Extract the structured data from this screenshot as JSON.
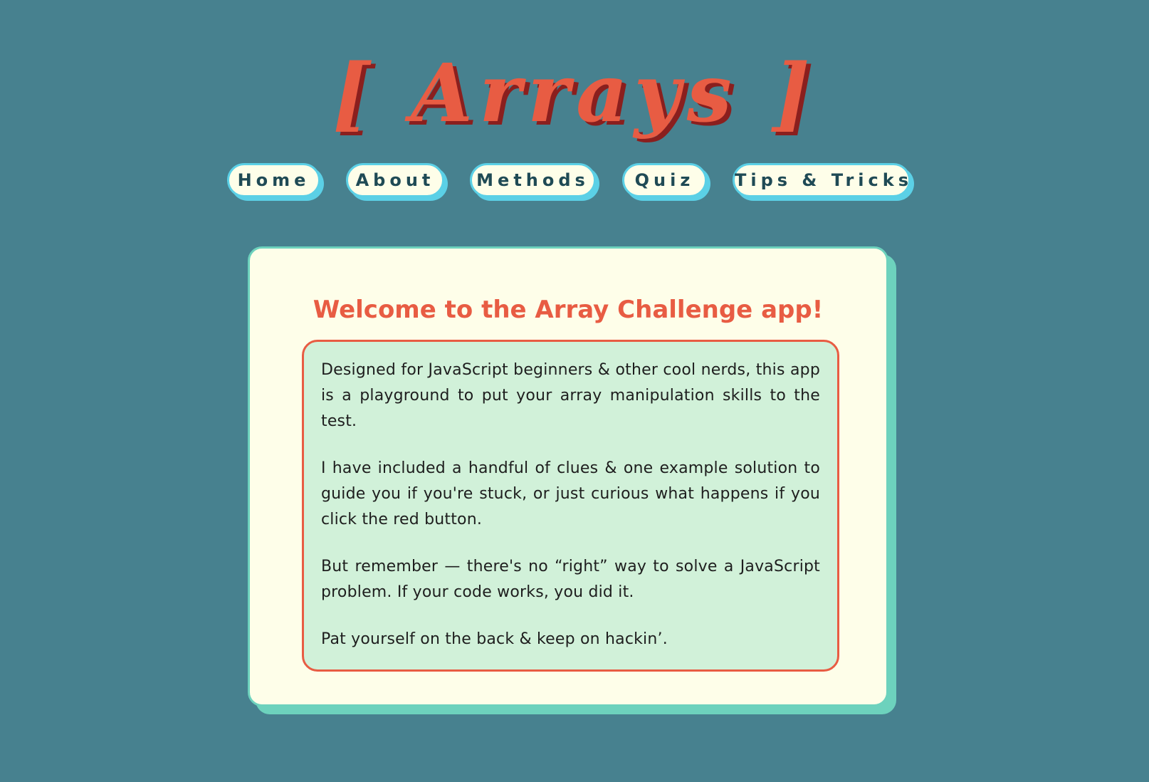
{
  "header": {
    "logo_text": "[ Arrays ]"
  },
  "nav": {
    "items": [
      {
        "label": "Home"
      },
      {
        "label": "About"
      },
      {
        "label": "Methods"
      },
      {
        "label": "Quiz"
      },
      {
        "label": "Tips & Tricks"
      }
    ]
  },
  "main": {
    "title": "Welcome to the Array Challenge app!",
    "paragraphs": [
      "Designed for JavaScript beginners & other cool nerds, this app is a playground to put your array manipulation skills to the test.",
      "I have included a handful of clues & one example solution to guide you if you're stuck, or just curious what happens if you click the red button.",
      "But remember — there's no “right” way to solve a JavaScript problem. If your code works, you did it.",
      "Pat yourself on the back & keep on hackin’."
    ]
  },
  "colors": {
    "background": "#47818f",
    "accent_red": "#e85c43",
    "logo_shadow": "#8a1f1e",
    "nav_border": "#5bd0e6",
    "card_border": "#6dd2bd",
    "card_bg": "#fefee9",
    "inner_bg": "#d1f1d9",
    "nav_text": "#1f4a55"
  }
}
